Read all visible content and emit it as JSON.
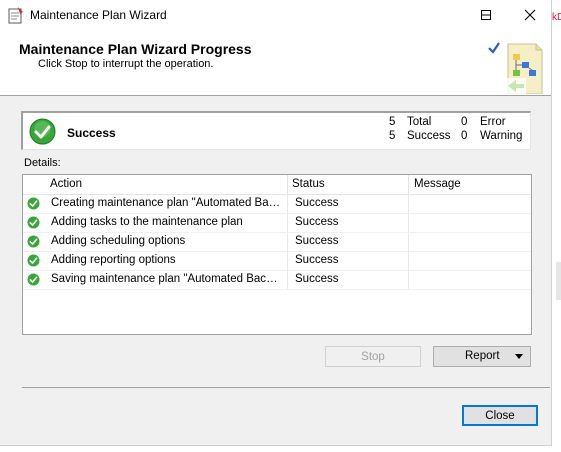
{
  "window": {
    "title": "Maintenance Plan Wizard"
  },
  "header": {
    "title": "Maintenance Plan Wizard Progress",
    "subtitle": "Click Stop to interrupt the operation."
  },
  "status": {
    "label": "Success",
    "total_count": "5",
    "total_label": "Total",
    "error_count": "0",
    "error_label": "Error",
    "success_count": "5",
    "success_label": "Success",
    "warning_count": "0",
    "warning_label": "Warning"
  },
  "details": {
    "label": "Details:",
    "columns": {
      "action": "Action",
      "status": "Status",
      "message": "Message"
    },
    "rows": [
      {
        "action": "Creating maintenance plan \"Automated Backup…",
        "status": "Success",
        "message": ""
      },
      {
        "action": "Adding tasks to the maintenance plan",
        "status": "Success",
        "message": ""
      },
      {
        "action": "Adding scheduling options",
        "status": "Success",
        "message": ""
      },
      {
        "action": "Adding reporting options",
        "status": "Success",
        "message": ""
      },
      {
        "action": "Saving maintenance plan \"Automated Backup…",
        "status": "Success",
        "message": ""
      }
    ]
  },
  "buttons": {
    "stop": "Stop",
    "report": "Report",
    "close": "Close"
  },
  "background": {
    "fragment": "kD"
  },
  "colors": {
    "success_green": "#3aa53a",
    "accent_blue": "#0078d7",
    "close_red": "#e81123"
  }
}
